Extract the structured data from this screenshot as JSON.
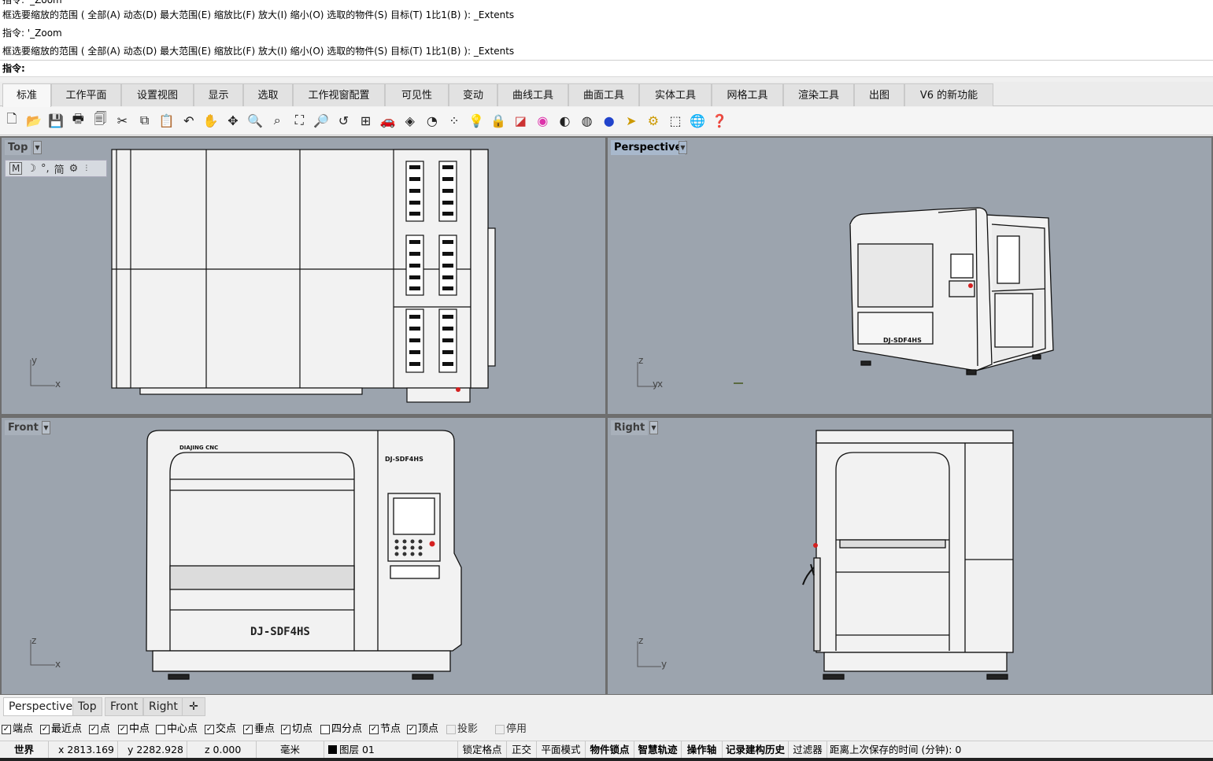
{
  "command_history": {
    "lines": [
      "指令: '_Zoom",
      "框选要缩放的范围 ( 全部(A)  动态(D)  最大范围(E)  缩放比(F)  放大(I)  缩小(O)  选取的物件(S)  目标(T)  1比1(B) ): _Extents",
      "指令: '_Zoom",
      "框选要缩放的范围 ( 全部(A)  动态(D)  最大范围(E)  缩放比(F)  放大(I)  缩小(O)  选取的物件(S)  目标(T)  1比1(B) ): _Extents"
    ],
    "prompt": "指令:"
  },
  "ribbon_tabs": [
    "标准",
    "工作平面",
    "设置视图",
    "显示",
    "选取",
    "工作视窗配置",
    "可见性",
    "变动",
    "曲线工具",
    "曲面工具",
    "实体工具",
    "网格工具",
    "渲染工具",
    "出图",
    "V6 的新功能"
  ],
  "active_tab": "标准",
  "toolbar_icons": [
    "new-file-icon",
    "open-folder-icon",
    "save-icon",
    "print-icon",
    "import-icon",
    "cut-icon",
    "copy-icon",
    "paste-icon",
    "undo-icon",
    "pan-hand-icon",
    "rotate-view-icon",
    "zoom-dynamic-icon",
    "zoom-window-icon",
    "zoom-extents-icon",
    "zoom-selected-icon",
    "undo-view-icon",
    "four-viewports-icon",
    "car-object-icon",
    "render-preview-icon",
    "circle-icon",
    "point-edit-icon",
    "light-bulb-icon",
    "lock-icon",
    "layer-icon",
    "color-wheel-icon",
    "shade-sphere-icon",
    "ghosted-sphere-icon",
    "render-sphere-icon",
    "cursor-select-icon",
    "gear-options-icon",
    "object-props-icon",
    "web-globe-icon",
    "help-icon"
  ],
  "viewports": {
    "top": {
      "label": "Top",
      "axis_a": "y",
      "axis_b": "x"
    },
    "perspective": {
      "label": "Perspective",
      "axis_a": "z",
      "axis_b": "x",
      "axis_c": "y"
    },
    "front": {
      "label": "Front",
      "axis_a": "z",
      "axis_b": "x"
    },
    "right": {
      "label": "Right",
      "axis_a": "z",
      "axis_b": "y"
    }
  },
  "float_snap_bar": [
    "M",
    "☽",
    "°,",
    "简",
    "⚙"
  ],
  "machine_model": "DJ-SDF4HS",
  "machine_brand": "DIAJING CNC",
  "viewport_tabs": [
    "Perspective",
    "Top",
    "Front",
    "Right"
  ],
  "active_viewport_tab": "Perspective",
  "osnaps": [
    {
      "label": "端点",
      "checked": true
    },
    {
      "label": "最近点",
      "checked": true
    },
    {
      "label": "点",
      "checked": true
    },
    {
      "label": "中点",
      "checked": true
    },
    {
      "label": "中心点",
      "checked": false
    },
    {
      "label": "交点",
      "checked": true
    },
    {
      "label": "垂点",
      "checked": true
    },
    {
      "label": "切点",
      "checked": true
    },
    {
      "label": "四分点",
      "checked": false
    },
    {
      "label": "节点",
      "checked": true
    },
    {
      "label": "顶点",
      "checked": true
    },
    {
      "label": "投影",
      "checked": false,
      "disabled": true
    },
    {
      "label": "停用",
      "checked": false,
      "disabled": true
    }
  ],
  "status_bar": {
    "cplane": "世界",
    "x": "x 2813.169",
    "y": "y 2282.928",
    "z": "z 0.000",
    "units": "毫米",
    "layer": "图层 01",
    "layer_color": "#000000",
    "toggles": [
      "锁定格点",
      "正交",
      "平面模式",
      "物件锁点",
      "智慧轨迹",
      "操作轴",
      "记录建构历史",
      "过滤器"
    ],
    "bold_toggles": [
      "物件锁点",
      "智慧轨迹",
      "操作轴",
      "记录建构历史"
    ],
    "save_info": "距离上次保存的时间 (分钟): 0"
  },
  "colors": {
    "viewport_bg": "#9ca4ae",
    "active_label": "#a8b8cc",
    "machine_fill": "#f2f2f2",
    "accent_red": "#d42020"
  }
}
